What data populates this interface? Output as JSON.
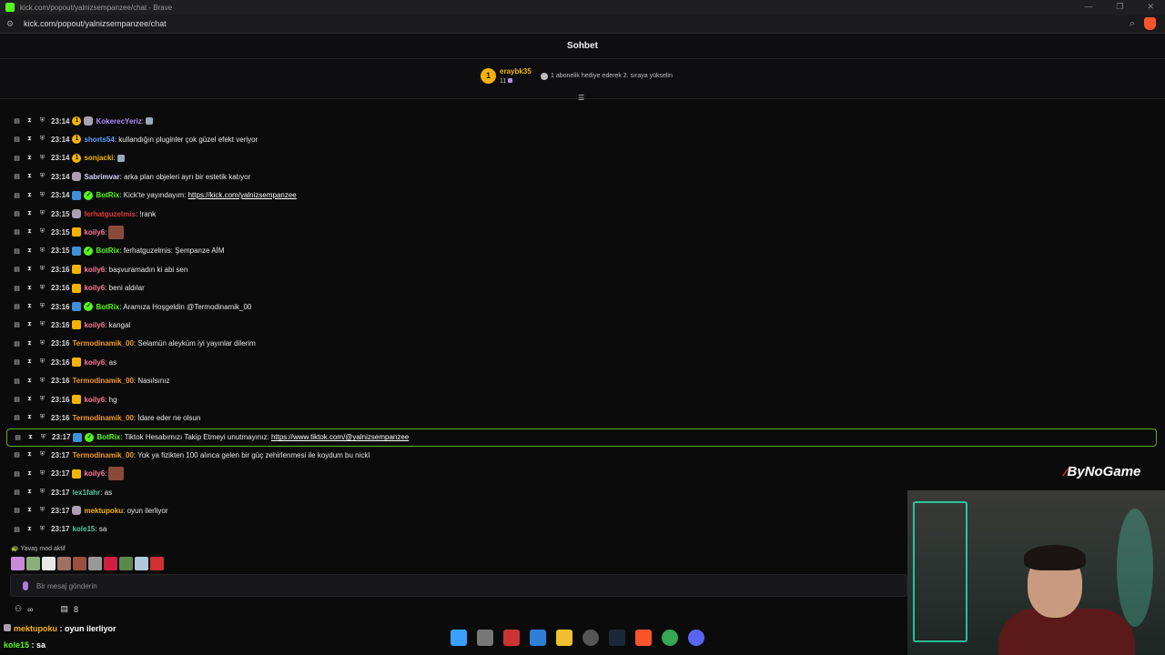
{
  "browser": {
    "window_title": "kick.com/popout/yalnizsempanzee/chat - Brave",
    "url": "kick.com/popout/yalnizsempanzee/chat"
  },
  "chat": {
    "title": "Sohbet",
    "pinned": {
      "rank": "1",
      "username": "eraybk35",
      "count": "11",
      "text": "1 abonelik hediye ederek 2. sıraya yükselin"
    },
    "messages": [
      {
        "time": "23:14",
        "badges": [
          "gold",
          "avatar"
        ],
        "user": "KokerecYeriz",
        "user_color": "#b48cff",
        "text": "",
        "link": "",
        "emote": "small"
      },
      {
        "time": "23:14",
        "badges": [
          "gold"
        ],
        "user": "shorts54",
        "user_color": "#5aa0ff",
        "text": " kullandığın pluginler çok güzel efekt veriyor",
        "link": "",
        "emote": ""
      },
      {
        "time": "23:14",
        "badges": [
          "gold"
        ],
        "user": "sonjacki",
        "user_color": "#f5b300",
        "text": "",
        "link": "",
        "emote": "small"
      },
      {
        "time": "23:14",
        "badges": [
          "avatar"
        ],
        "user": "Sabrimvar",
        "user_color": "#d7d7ff",
        "text": " arka plan objeleri ayrı bir estetik katıyor",
        "link": "",
        "emote": ""
      },
      {
        "time": "23:14",
        "badges": [
          "bot",
          "verified"
        ],
        "user": "BotRix",
        "user_color": "#53fc18",
        "text": " Kick'te yayındayım: ",
        "link": "https://kick.com/yalnizsempanzee",
        "emote": ""
      },
      {
        "time": "23:15",
        "badges": [
          "avatar"
        ],
        "user": "ferhatguzelmis",
        "user_color": "#e03a3a",
        "text": " !rank",
        "link": "",
        "emote": ""
      },
      {
        "time": "23:15",
        "badges": [
          "crown"
        ],
        "user": "koily6",
        "user_color": "#ff7a9a",
        "text": "",
        "link": "",
        "emote": "big"
      },
      {
        "time": "23:15",
        "badges": [
          "bot",
          "verified"
        ],
        "user": "BotRix",
        "user_color": "#53fc18",
        "text": " ferhatguzelmis: Şempanze AİM",
        "link": "",
        "emote": ""
      },
      {
        "time": "23:16",
        "badges": [
          "crown"
        ],
        "user": "koily6",
        "user_color": "#ff7a9a",
        "text": " başvuramadın ki abi sen",
        "link": "",
        "emote": ""
      },
      {
        "time": "23:16",
        "badges": [
          "crown"
        ],
        "user": "koily6",
        "user_color": "#ff7a9a",
        "text": " beni aldılar",
        "link": "",
        "emote": ""
      },
      {
        "time": "23:16",
        "badges": [
          "bot",
          "verified"
        ],
        "user": "BotRix",
        "user_color": "#53fc18",
        "text": " Aramıza Hoşgeldin @Termodinamik_00",
        "link": "",
        "emote": ""
      },
      {
        "time": "23:16",
        "badges": [
          "crown"
        ],
        "user": "koily6",
        "user_color": "#ff7a9a",
        "text": " kangal",
        "link": "",
        "emote": ""
      },
      {
        "time": "23:16",
        "badges": [],
        "user": "Termodinamik_00",
        "user_color": "#f59a2a",
        "text": " Selamün aleyküm iyi yayınlar dilerim",
        "link": "",
        "emote": ""
      },
      {
        "time": "23:16",
        "badges": [
          "crown"
        ],
        "user": "koily6",
        "user_color": "#ff7a9a",
        "text": " as",
        "link": "",
        "emote": ""
      },
      {
        "time": "23:16",
        "badges": [],
        "user": "Termodinamik_00",
        "user_color": "#f59a2a",
        "text": " Nasılsınız",
        "link": "",
        "emote": ""
      },
      {
        "time": "23:16",
        "badges": [
          "crown"
        ],
        "user": "koily6",
        "user_color": "#ff7a9a",
        "text": " hg",
        "link": "",
        "emote": ""
      },
      {
        "time": "23:16",
        "badges": [],
        "user": "Termodinamik_00",
        "user_color": "#f59a2a",
        "text": " İdare eder ne olsun",
        "link": "",
        "emote": ""
      },
      {
        "time": "23:17",
        "badges": [
          "bot",
          "verified"
        ],
        "user": "BotRix",
        "user_color": "#53fc18",
        "text": " Tiktok Hesabımızı Takip Etmeyi unutmayınız: ",
        "link": "https://www.tiktok.com/@yalnizsempanzee",
        "emote": "",
        "highlight": true
      },
      {
        "time": "23:17",
        "badges": [],
        "user": "Termodinamik_00",
        "user_color": "#f59a2a",
        "text": " Yok ya fizikten 100 alınca gelen bir güç zehirlenmesi ile koydum bu nickl",
        "link": "",
        "emote": ""
      },
      {
        "time": "23:17",
        "badges": [
          "crown"
        ],
        "user": "koily6",
        "user_color": "#ff7a9a",
        "text": "",
        "link": "",
        "emote": "big"
      },
      {
        "time": "23:17",
        "badges": [],
        "user": "lex1fahr",
        "user_color": "#53c8a0",
        "text": " as",
        "link": "",
        "emote": ""
      },
      {
        "time": "23:17",
        "badges": [
          "avatar"
        ],
        "user": "mektupoku",
        "user_color": "#f5b300",
        "text": " oyun ilerliyor",
        "link": "",
        "emote": ""
      },
      {
        "time": "23:17",
        "badges": [],
        "user": "kole15",
        "user_color": "#53c8a0",
        "text": " sa",
        "link": "",
        "emote": ""
      }
    ],
    "slow_mode": "Yavaş mod aktif",
    "input_placeholder": "Bir mesaj gönderin",
    "viewer_icon_text": "∞",
    "count_text": "8"
  },
  "overlay": {
    "lines": [
      {
        "user": "mektupoku",
        "text": " : oyun ilerliyor",
        "user_color": "#f5b300"
      },
      {
        "user": "kole15",
        "text": " : sa",
        "user_color": "#53fc18"
      }
    ],
    "logo_text": "ByNoGame"
  },
  "colors": {
    "kick_green": "#53fc18",
    "background": "#0b0b0c",
    "highlight_border": "#5fae1f"
  }
}
